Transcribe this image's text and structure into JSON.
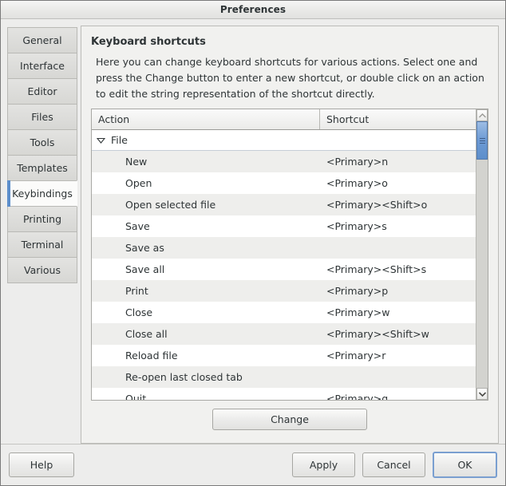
{
  "window": {
    "title": "Preferences"
  },
  "sidebar": {
    "items": [
      {
        "label": "General",
        "selected": false
      },
      {
        "label": "Interface",
        "selected": false
      },
      {
        "label": "Editor",
        "selected": false
      },
      {
        "label": "Files",
        "selected": false
      },
      {
        "label": "Tools",
        "selected": false
      },
      {
        "label": "Templates",
        "selected": false
      },
      {
        "label": "Keybindings",
        "selected": true
      },
      {
        "label": "Printing",
        "selected": false
      },
      {
        "label": "Terminal",
        "selected": false
      },
      {
        "label": "Various",
        "selected": false
      }
    ],
    "selected_accent_color": "#5c8ecb"
  },
  "content": {
    "heading": "Keyboard shortcuts",
    "description": "Here you can change keyboard shortcuts for various actions. Select one and press the Change button to enter a new shortcut, or double click on an action to edit the string representation of the shortcut directly."
  },
  "table": {
    "columns": [
      "Action",
      "Shortcut"
    ],
    "groups": [
      {
        "label": "File",
        "expanded": true,
        "expander_icon": "triangle-down-icon",
        "rows": [
          {
            "action": "New",
            "shortcut": "<Primary>n"
          },
          {
            "action": "Open",
            "shortcut": "<Primary>o"
          },
          {
            "action": "Open selected file",
            "shortcut": "<Primary><Shift>o"
          },
          {
            "action": "Save",
            "shortcut": "<Primary>s"
          },
          {
            "action": "Save as",
            "shortcut": ""
          },
          {
            "action": "Save all",
            "shortcut": "<Primary><Shift>s"
          },
          {
            "action": "Print",
            "shortcut": "<Primary>p"
          },
          {
            "action": "Close",
            "shortcut": "<Primary>w"
          },
          {
            "action": "Close all",
            "shortcut": "<Primary><Shift>w"
          },
          {
            "action": "Reload file",
            "shortcut": "<Primary>r"
          },
          {
            "action": "Re-open last closed tab",
            "shortcut": ""
          },
          {
            "action": "Quit",
            "shortcut": "<Primary>q"
          }
        ]
      }
    ],
    "scrollbar": {
      "up_icon": "chevron-up-icon",
      "down_icon": "chevron-down-icon",
      "thumb_color": "#6d9ad4"
    }
  },
  "buttons": {
    "change": "Change",
    "help": "Help",
    "apply": "Apply",
    "cancel": "Cancel",
    "ok": "OK"
  }
}
